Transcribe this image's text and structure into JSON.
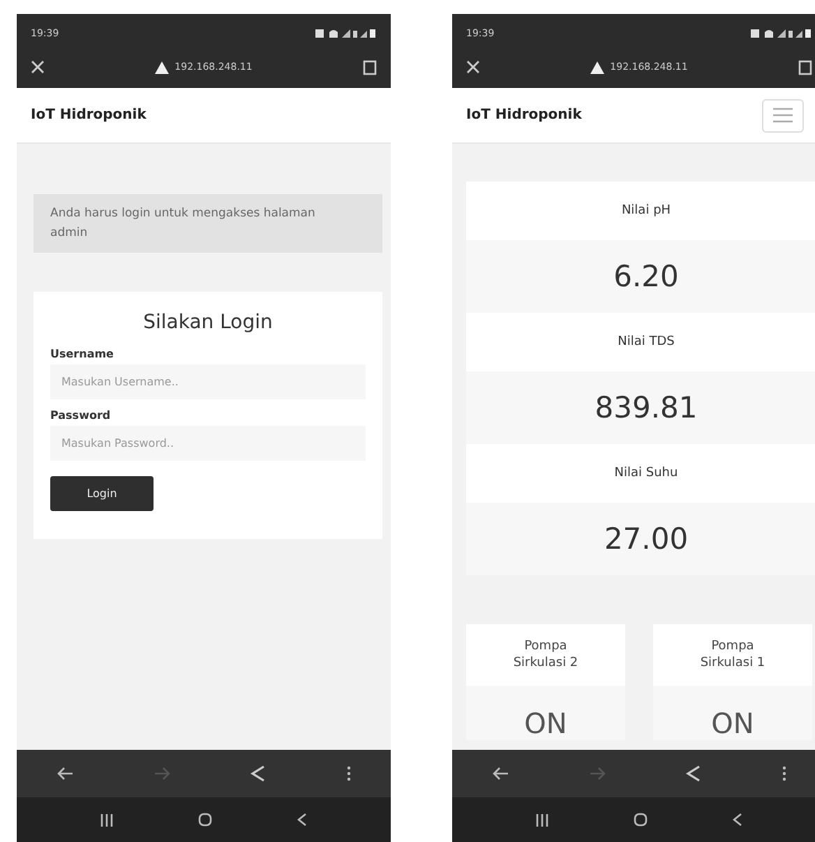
{
  "screens": [
    {
      "kind": "login",
      "status": {
        "time": "19:39"
      },
      "browser": {
        "url": "192.168.248.11",
        "forward_disabled": true
      },
      "header": {
        "title": "IoT Hidroponik",
        "menu": false
      },
      "alert": "Anda harus login untuk mengakses halaman admin",
      "login": {
        "title": "Silakan Login",
        "fields": [
          {
            "label": "Username",
            "placeholder": "Masukan Username.."
          },
          {
            "label": "Password",
            "placeholder": "Masukan Password.."
          }
        ],
        "button": "Login"
      }
    },
    {
      "kind": "dashboard",
      "status": {
        "time": "19:39"
      },
      "browser": {
        "url": "192.168.248.11",
        "forward_disabled": true
      },
      "header": {
        "title": "IoT Hidroponik",
        "menu": true
      },
      "readings": [
        {
          "label": "Nilai pH",
          "value": "6.20"
        },
        {
          "label": "Nilai TDS",
          "value": "839.81"
        },
        {
          "label": "Nilai Suhu",
          "value": "27.00"
        }
      ],
      "pumps": [
        {
          "label": "Pompa Sirkulasi 2",
          "state": "ON"
        },
        {
          "label": "Pompa Sirkulasi 1",
          "state": "ON"
        }
      ]
    }
  ]
}
